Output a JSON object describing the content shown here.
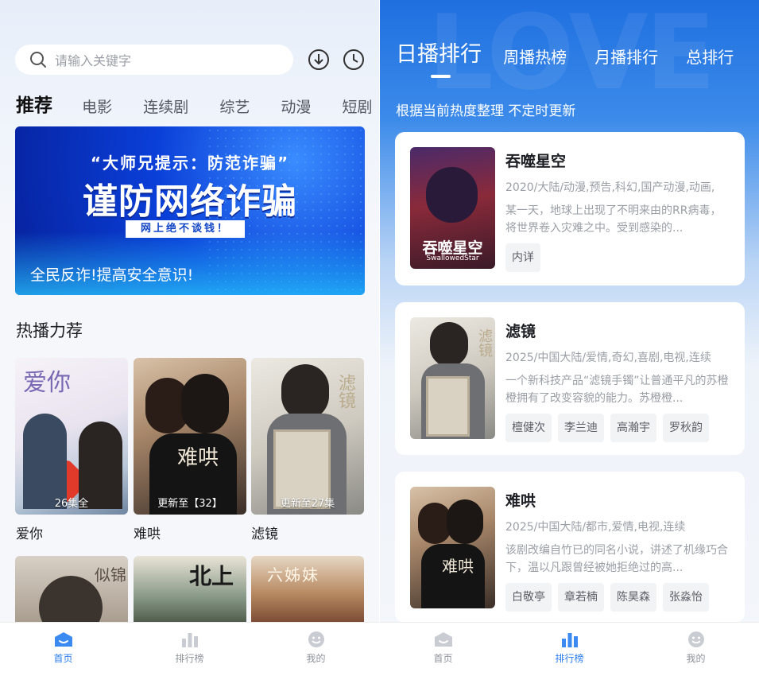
{
  "left": {
    "search": {
      "placeholder": "请输入关键字"
    },
    "categories": [
      "推荐",
      "电影",
      "连续剧",
      "综艺",
      "动漫",
      "短剧"
    ],
    "banner": {
      "line1": "“大师兄提示：防范诈骗”",
      "line2": "谨防网络诈骗",
      "line3": "网上绝不谈钱！",
      "line4": "全民反诈!提高安全意识!"
    },
    "section_title": "热播力荐",
    "posters": [
      {
        "title": "爱你",
        "caption": "26集全",
        "overlay": "爱你"
      },
      {
        "title": "难哄",
        "caption": "更新至【32】",
        "overlay": "难哄"
      },
      {
        "title": "滤镜",
        "caption": "更新至27集",
        "overlay": "滤镜"
      }
    ],
    "posters_row2": [
      {
        "overlay": "似锦"
      },
      {
        "overlay": "北上"
      },
      {
        "overlay": "六姊妹"
      }
    ]
  },
  "tabbar": {
    "home": "首页",
    "ranking": "排行榜",
    "mine": "我的"
  },
  "right": {
    "tabs": [
      "日播排行",
      "周播热榜",
      "月播排行",
      "总排行"
    ],
    "subtitle": "根据当前热度整理 不定时更新",
    "watermark": "LOVE",
    "cards": [
      {
        "title": "吞噬星空",
        "meta": "2020/大陆/动漫,预告,科幻,国产动漫,动画,",
        "desc": "某一天，地球上出现了不明来由的RR病毒，将世界卷入灾难之中。受到感染的...",
        "tags": [
          "内详"
        ],
        "cover_text": "吞噬星空",
        "cover_sub": "SwallowedStar"
      },
      {
        "title": "滤镜",
        "meta": "2025/中国大陆/爱情,奇幻,喜剧,电视,连续",
        "desc": "一个新科技产品“滤镜手镯”让普通平凡的苏橙橙拥有了改变容貌的能力。苏橙橙...",
        "tags": [
          "檀健次",
          "李兰迪",
          "高瀚宇",
          "罗秋韵"
        ],
        "cover_text": "滤镜"
      },
      {
        "title": "难哄",
        "meta": "2025/中国大陆/都市,爱情,电视,连续",
        "desc": "该剧改编自竹已的同名小说，讲述了机缘巧合下，温以凡跟曾经被她拒绝过的高...",
        "tags": [
          "白敬亭",
          "章若楠",
          "陈昊森",
          "张淼怡"
        ],
        "cover_text": "难哄"
      }
    ]
  },
  "colors": {
    "accent": "#2a7df0",
    "banner_blue": "#0a3fd8"
  }
}
